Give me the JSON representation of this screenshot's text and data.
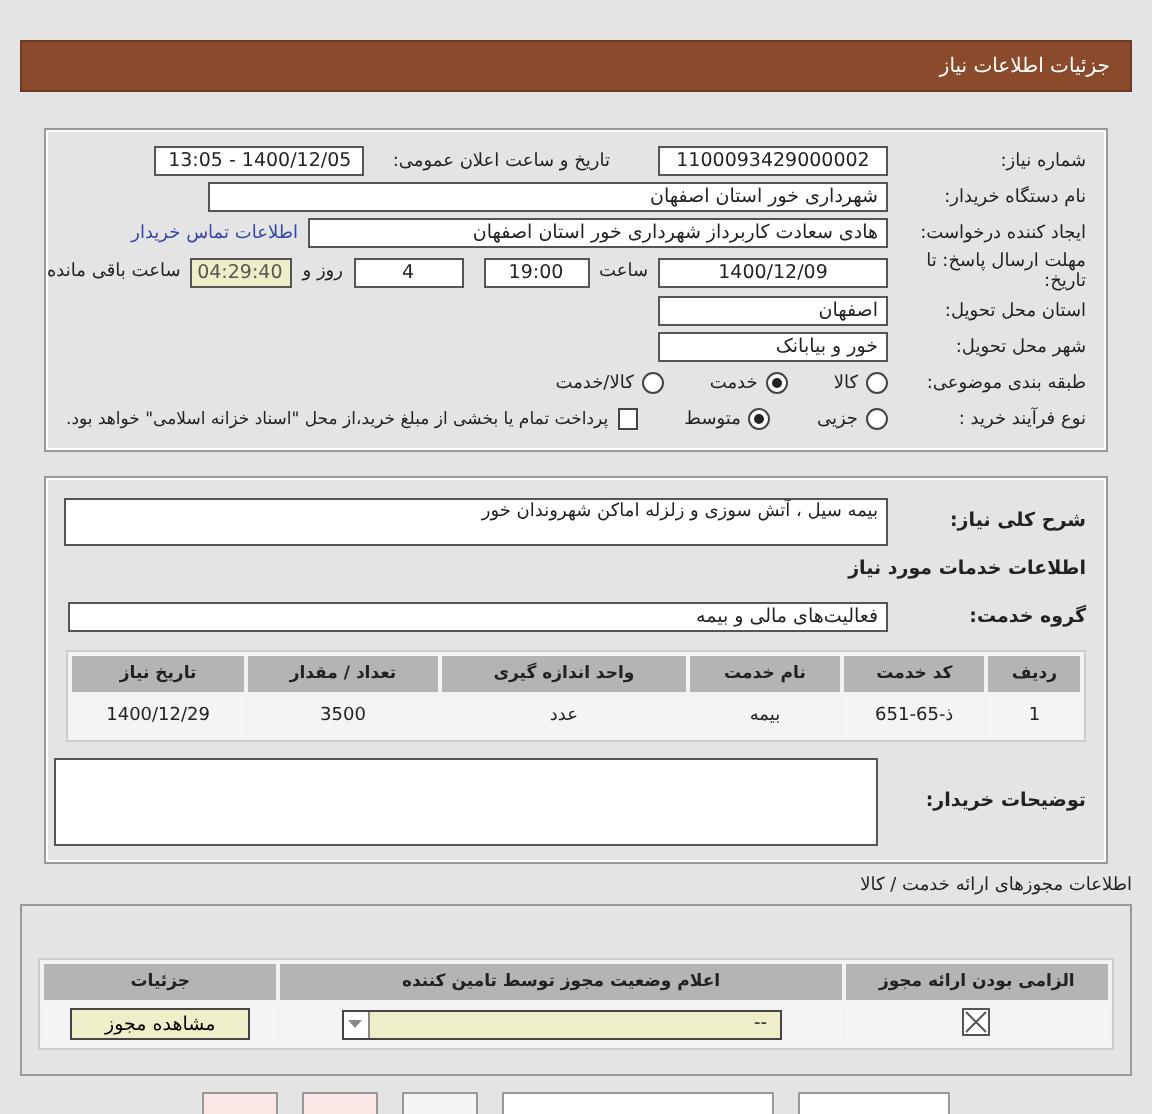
{
  "header": {
    "title": "جزئیات اطلاعات نیاز"
  },
  "details": {
    "need_number": {
      "label": "شماره نیاز:",
      "value": "1100093429000002"
    },
    "announce": {
      "label": "تاریخ و ساعت اعلان عمومی:",
      "value": "1400/12/05 - 13:05"
    },
    "buyer": {
      "label": "نام دستگاه خریدار:",
      "value": "شهرداری خور استان اصفهان"
    },
    "creator": {
      "label": "ایجاد کننده درخواست:",
      "value": "هادی سعادت کاربرداز شهرداری خور استان اصفهان",
      "link": "اطلاعات تماس خریدار"
    },
    "deadline": {
      "label": "مهلت ارسال پاسخ: تا تاریخ:",
      "date": "1400/12/09",
      "time_label": "ساعت",
      "time": "19:00",
      "days": "4",
      "days_label": "روز و",
      "remaining": "04:29:40",
      "remaining_label": "ساعت باقی مانده"
    },
    "province": {
      "label": "استان محل تحویل:",
      "value": "اصفهان"
    },
    "city": {
      "label": "شهر محل تحویل:",
      "value": "خور و بیابانک"
    },
    "category": {
      "label": "طبقه بندی موضوعی:",
      "options": [
        {
          "label": "کالا",
          "selected": false
        },
        {
          "label": "خدمت",
          "selected": true
        },
        {
          "label": "کالا/خدمت",
          "selected": false
        }
      ]
    },
    "process": {
      "label": "نوع فرآیند خرید :",
      "options": [
        {
          "label": "جزیی",
          "selected": false
        },
        {
          "label": "متوسط",
          "selected": true
        }
      ],
      "treasury": {
        "label": "پرداخت تمام یا بخشی از مبلغ خرید،از محل \"اسناد خزانه اسلامی\" خواهد بود.",
        "checked": false
      }
    }
  },
  "services": {
    "summary": {
      "label": "شرح کلی نیاز:",
      "value": "بیمه سیل ، آتش سوزی و زلزله اماکن شهروندان خور"
    },
    "heading": "اطلاعات خدمات مورد نیاز",
    "group": {
      "label": "گروه خدمت:",
      "value": "فعالیت‌های مالی و بیمه"
    },
    "table": {
      "columns": [
        "ردیف",
        "کد خدمت",
        "نام خدمت",
        "واحد اندازه گیری",
        "تعداد / مقدار",
        "تاریخ نیاز"
      ],
      "rows": [
        [
          "1",
          "ذ-65-651",
          "بیمه",
          "عدد",
          "3500",
          "1400/12/29"
        ]
      ]
    },
    "notes": {
      "label": "توضیحات خریدار:"
    }
  },
  "permits": {
    "title": "اطلاعات مجوزهای ارائه خدمت / کالا",
    "columns": [
      "الزامی بودن ارائه مجوز",
      "اعلام وضعیت مجوز توسط تامین کننده",
      "جزئیات"
    ],
    "rows": [
      {
        "required": true,
        "status": "--",
        "action": "مشاهده مجوز"
      }
    ]
  },
  "bottom_buttons": [
    {
      "color": "#ffffff"
    },
    {
      "color": "#ffffff"
    },
    {
      "color": "#f4f4f4"
    },
    {
      "color": "#fbe6e6"
    },
    {
      "color": "#fbe6e6"
    }
  ]
}
